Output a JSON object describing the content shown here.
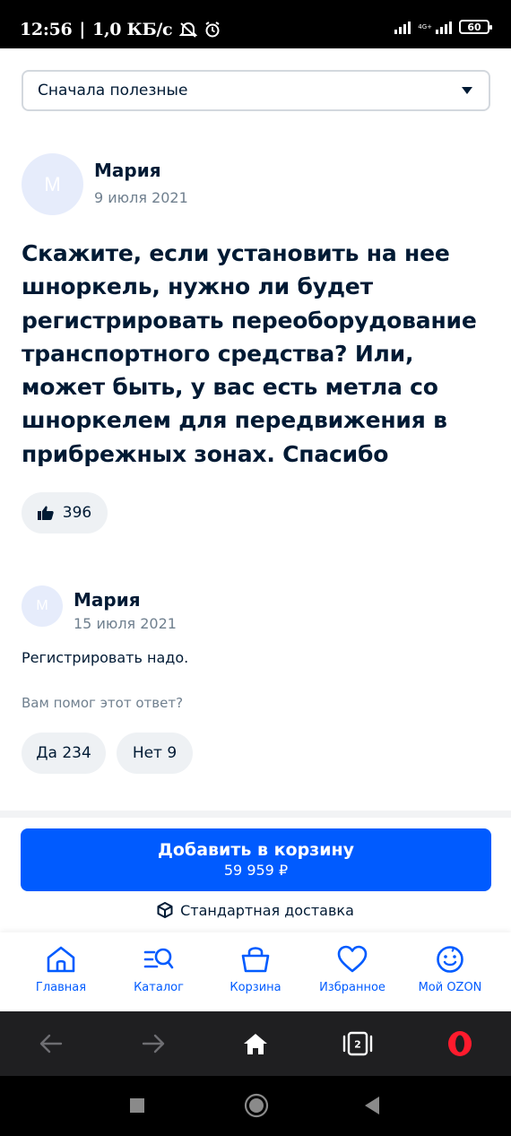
{
  "status_bar": {
    "time": "12:56",
    "speed": "1,0 КБ/с",
    "network_tag": "4G+",
    "battery": "60"
  },
  "sort": {
    "label": "Сначала полезные"
  },
  "review": {
    "avatar_letter": "М",
    "author": "Мария",
    "date": "9 июля 2021",
    "text": "Скажите, если установить на нее шноркель, нужно ли будет регистрировать переоборудование транспортного средства? Или, может быть, у вас есть метла со шноркелем для передвижения в прибрежных зонах. Спасибо",
    "likes": "396"
  },
  "answer": {
    "avatar_letter": "М",
    "author": "Мария",
    "date": "15 июля 2021",
    "text": "Регистрировать надо.",
    "helpful_question": "Вам помог этот ответ?",
    "yes_label": "Да 234",
    "no_label": "Нет 9"
  },
  "cart": {
    "button_title": "Добавить в корзину",
    "price": "59 959 ₽",
    "delivery": "Стандартная доставка"
  },
  "bottom_nav": {
    "items": [
      {
        "label": "Главная",
        "icon": "home-icon"
      },
      {
        "label": "Каталог",
        "icon": "catalog-search-icon"
      },
      {
        "label": "Корзина",
        "icon": "basket-icon"
      },
      {
        "label": "Избранное",
        "icon": "heart-icon"
      },
      {
        "label": "Мой OZON",
        "icon": "smiley-icon"
      }
    ],
    "accent_color": "#005bff"
  },
  "browser_bar": {
    "tabs_count": "2",
    "icons": [
      "back-arrow-icon",
      "forward-arrow-icon",
      "home-icon",
      "tabs-icon",
      "opera-icon"
    ]
  },
  "colors": {
    "primary": "#005bff",
    "text": "#001a34",
    "muted": "#70808f",
    "pill_bg": "#eef1f4",
    "opera_red": "#ff1b2d"
  }
}
